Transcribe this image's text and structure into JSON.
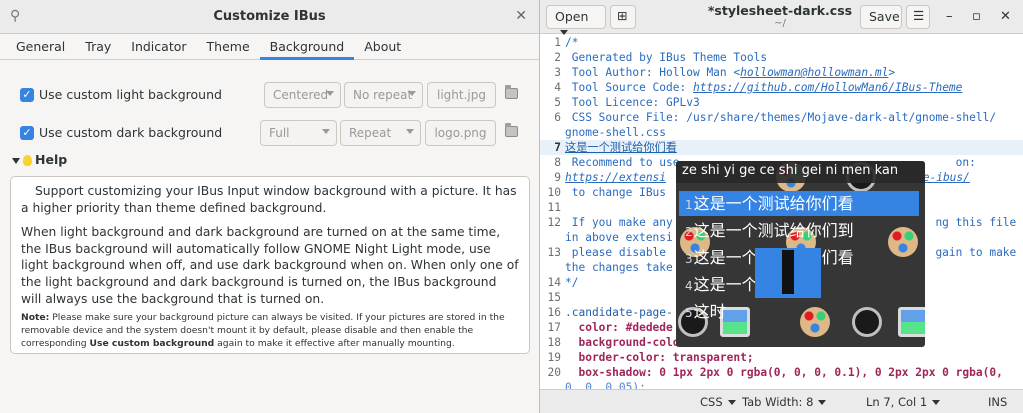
{
  "ibus": {
    "title": "Customize IBus",
    "tabs": [
      "General",
      "Tray",
      "Indicator",
      "Theme",
      "Background",
      "About"
    ],
    "active_tab": "Background",
    "light": {
      "label": "Use custom light background",
      "position": "Centered",
      "repeat": "No repeat",
      "file": "light.jpg"
    },
    "dark": {
      "label": "Use custom dark background",
      "position": "Full",
      "repeat": "Repeat",
      "file": "logo.png"
    },
    "help": {
      "heading": "Help",
      "p1": "Support customizing your IBus Input window background with a picture. It has a higher priority than theme defined background.",
      "p2": "When light background and dark background are turned on at the same time, the IBus background will automatically follow GNOME Night Light mode, use light background when off, and use dark background when on. When only one of the light background and dark background is turned on, the IBus background will always use the background that is turned on.",
      "note_label": "Note:",
      "note_text": " Please make sure your background picture can always be visited. If your pictures are stored in the removable device and the system doesn't mount it by default, please disable and then enable the corresponding ",
      "note_bold": "Use custom background",
      "note_tail": " again to make it effective after manually mounting."
    }
  },
  "gedit": {
    "open_label": "Open",
    "save_label": "Save",
    "doc_title": "*stylesheet-dark.css",
    "doc_path": "~/",
    "status": {
      "language": "CSS",
      "tab_width": "Tab Width: 8",
      "position": "Ln 7, Col 1",
      "mode": "INS"
    },
    "lines": [
      {
        "n": "1",
        "text": "/*"
      },
      {
        "n": "2",
        "text": " Generated by IBus Theme Tools"
      },
      {
        "n": "3",
        "text": " Tool Author: Hollow Man <",
        "link": "hollowman@hollowman.ml",
        "tail": ">"
      },
      {
        "n": "4",
        "text": " Tool Source Code: ",
        "link": "https://github.com/HollowMan6/IBus-Theme",
        "tail": ""
      },
      {
        "n": "5",
        "text": " Tool Licence: GPLv3"
      },
      {
        "n": "6",
        "text": " CSS Source File: /usr/share/themes/Mojave-dark-alt/gnome-shell/"
      },
      {
        "n": "",
        "text": "gnome-shell.css"
      },
      {
        "n": "7",
        "text": "这是一个测试给你们看"
      },
      {
        "n": "8",
        "text": " Recommend to use                                         on:"
      },
      {
        "n": "9",
        "text": "",
        "link": "https://extensi",
        "mid": "ze shi yi ge ce shi gei ni men kan",
        "tail2": "ze-ibus/"
      },
      {
        "n": "10",
        "text": " to change IBus"
      },
      {
        "n": "11",
        "text": ""
      },
      {
        "n": "12",
        "text": " If you make any                                       ng this file"
      },
      {
        "n": "",
        "text": "in above extensi"
      },
      {
        "n": "13",
        "text": " please disable                                        gain to make"
      },
      {
        "n": "",
        "text": "the changes take"
      },
      {
        "n": "14",
        "text": "*/"
      },
      {
        "n": "15",
        "text": ""
      },
      {
        "n": "16",
        "text": ".candidate-page-"
      },
      {
        "n": "17",
        "text": "  color: #dedede"
      },
      {
        "n": "18",
        "text": "  background-colo"
      },
      {
        "n": "19",
        "text": "  border-color: transparent;"
      },
      {
        "n": "20",
        "text": "  box-shadow: 0 1px 2px 0 rgba(0, 0, 0, 0.1), 0 2px 2px 0 rgba(0,"
      },
      {
        "n": "",
        "text": "0, 0, 0.05);"
      }
    ]
  },
  "candidate": {
    "preedit": "ze shi yi ge ce shi gei ni men kan",
    "items": [
      {
        "num": "1",
        "text": "这是一个测试给你们看"
      },
      {
        "num": "2",
        "text": "这是一个测试给你们到"
      },
      {
        "num": "3",
        "text": "这是一个册是给你们看"
      },
      {
        "num": "4",
        "text": "这是一个"
      },
      {
        "num": "5",
        "text": "这时"
      }
    ],
    "active_index": 0
  }
}
